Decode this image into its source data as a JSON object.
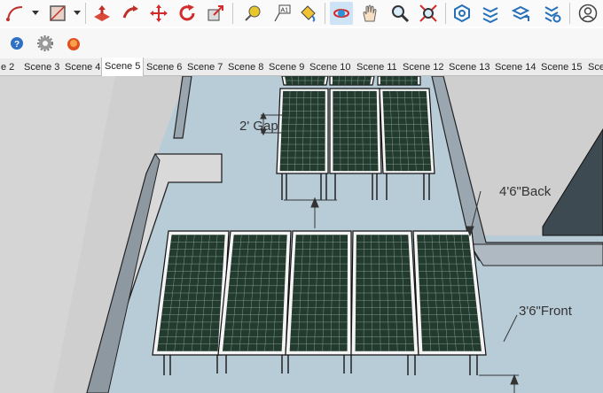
{
  "toolbar": {
    "tools": [
      {
        "name": "arc-tool",
        "icon": "arc-icon"
      },
      {
        "name": "shape-tool",
        "icon": "rectangle-icon"
      },
      {
        "name": "push-pull-tool",
        "icon": "push-pull-icon"
      },
      {
        "name": "follow-me-tool",
        "icon": "follow-me-icon"
      },
      {
        "name": "move-tool",
        "icon": "move-icon"
      },
      {
        "name": "rotate-tool",
        "icon": "rotate-icon"
      },
      {
        "name": "scale-tool",
        "icon": "scale-icon"
      },
      {
        "name": "tape-measure-tool",
        "icon": "tape-measure-icon"
      },
      {
        "name": "text-tool",
        "icon": "text-icon",
        "label": "A1"
      },
      {
        "name": "paint-bucket-tool",
        "icon": "paint-bucket-icon"
      },
      {
        "name": "orbit-tool",
        "icon": "orbit-icon"
      },
      {
        "name": "pan-tool",
        "icon": "pan-icon"
      },
      {
        "name": "zoom-tool",
        "icon": "zoom-icon"
      },
      {
        "name": "zoom-extents-tool",
        "icon": "zoom-extents-icon"
      },
      {
        "name": "warehouse-tool",
        "icon": "warehouse-icon"
      },
      {
        "name": "extension-warehouse-tool",
        "icon": "extension-warehouse-icon"
      },
      {
        "name": "share-model-tool",
        "icon": "share-model-icon"
      },
      {
        "name": "extension-manager-tool",
        "icon": "extension-manager-icon"
      },
      {
        "name": "account-button",
        "icon": "account-icon"
      }
    ],
    "secondary": [
      {
        "name": "help-button",
        "icon": "help-icon"
      },
      {
        "name": "settings-button",
        "icon": "gear-icon"
      },
      {
        "name": "ruby-console-button",
        "icon": "ruby-icon"
      }
    ],
    "active_tool": "orbit-tool",
    "accent": "#cfe3f7"
  },
  "scene_tabs": {
    "active": "Scene 5",
    "items": [
      "e 2",
      "Scene 3",
      "Scene 4",
      "Scene 5",
      "Scene 6",
      "Scene 7",
      "Scene 8",
      "Scene 9",
      "Scene 10",
      "Scene 11",
      "Scene 12",
      "Scene 13",
      "Scene 14",
      "Scene 15",
      "Sce"
    ]
  },
  "viewport": {
    "annotations": {
      "gap": "2' Gap",
      "back": "4'6\"Back",
      "front": "3'6\"Front"
    },
    "colors": {
      "roof": "#b8ccd8",
      "wall_top": "#d7d7d7",
      "wall_side": "#8f9aa3",
      "panel_frame": "#f4f4f4",
      "panel_cell": "#233a2f",
      "sky": "#d0d0d0"
    }
  }
}
